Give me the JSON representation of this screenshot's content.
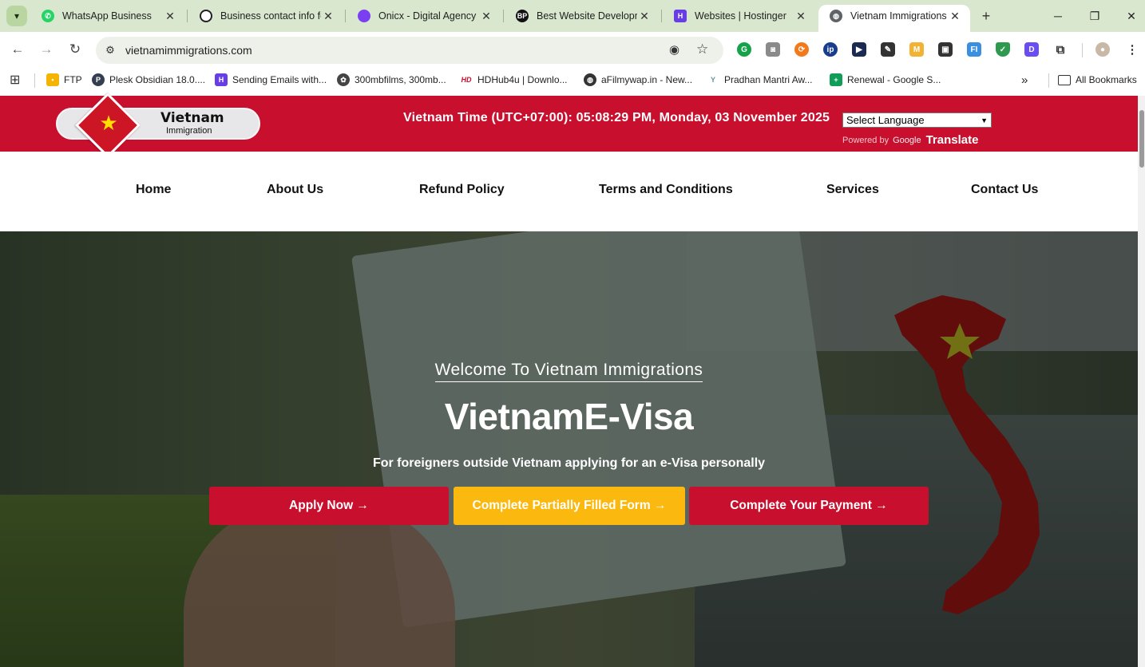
{
  "browser": {
    "tabs": [
      {
        "title": "WhatsApp Business",
        "icon": "whatsapp-icon",
        "color": "#25d366"
      },
      {
        "title": "Business contact info fo",
        "icon": "chatgpt-icon",
        "color": "#222222"
      },
      {
        "title": "Onicx - Digital Agency I",
        "icon": "onicx-icon",
        "color": "#7b3ff2"
      },
      {
        "title": "Best Website Developm",
        "icon": "bp-icon",
        "color": "#111111"
      },
      {
        "title": "Websites | Hostinger",
        "icon": "hostinger-icon",
        "color": "#673de6"
      },
      {
        "title": "Vietnam Immigrations",
        "icon": "globe-icon",
        "color": "#5f6368"
      }
    ],
    "url": "vietnamimmigrations.com",
    "bookmarks": [
      {
        "label": "FTP",
        "icon": "folder-ftp-icon",
        "color": "#f4b400"
      },
      {
        "label": "Plesk Obsidian 18.0....",
        "icon": "plesk-icon",
        "color": "#333f50"
      },
      {
        "label": "Sending Emails with...",
        "icon": "hostinger-icon",
        "color": "#673de6"
      },
      {
        "label": "300mbfilms, 300mb...",
        "icon": "film-icon",
        "color": "#444444"
      },
      {
        "label": "HDHub4u | Downlo...",
        "icon": "hd-icon",
        "color": "#c8102e"
      },
      {
        "label": "aFilmywap.in - New...",
        "icon": "globe-icon",
        "color": "#333333"
      },
      {
        "label": "Pradhan Mantri Aw...",
        "icon": "pmay-icon",
        "color": "#6b8e9f"
      },
      {
        "label": "Renewal - Google S...",
        "icon": "sheets-icon",
        "color": "#0f9d58"
      }
    ],
    "all_bookmarks": "All Bookmarks"
  },
  "site": {
    "logo": {
      "title": "Vietnam",
      "subtitle": "Immigration"
    },
    "time_text": "Vietnam Time (UTC+07:00): 05:08:29 PM, Monday, 03 November 2025",
    "language_select": "Select Language",
    "powered_by": "Powered by",
    "google": "Google",
    "translate": "Translate",
    "nav": [
      "Home",
      "About Us",
      "Refund Policy",
      "Terms and Conditions",
      "Services",
      "Contact Us"
    ],
    "hero": {
      "welcome": "Welcome To Vietnam Immigrations",
      "headline": "VietnamE-Visa",
      "subline": "For foreigners outside Vietnam applying for an e-Visa personally",
      "buttons": [
        "Apply Now →",
        "Complete Partially Filled Form →",
        "Complete Your Payment →"
      ]
    },
    "colors": {
      "brand_red": "#c8102e",
      "accent_yellow": "#fbb80f",
      "star_yellow": "#ffde00"
    }
  }
}
